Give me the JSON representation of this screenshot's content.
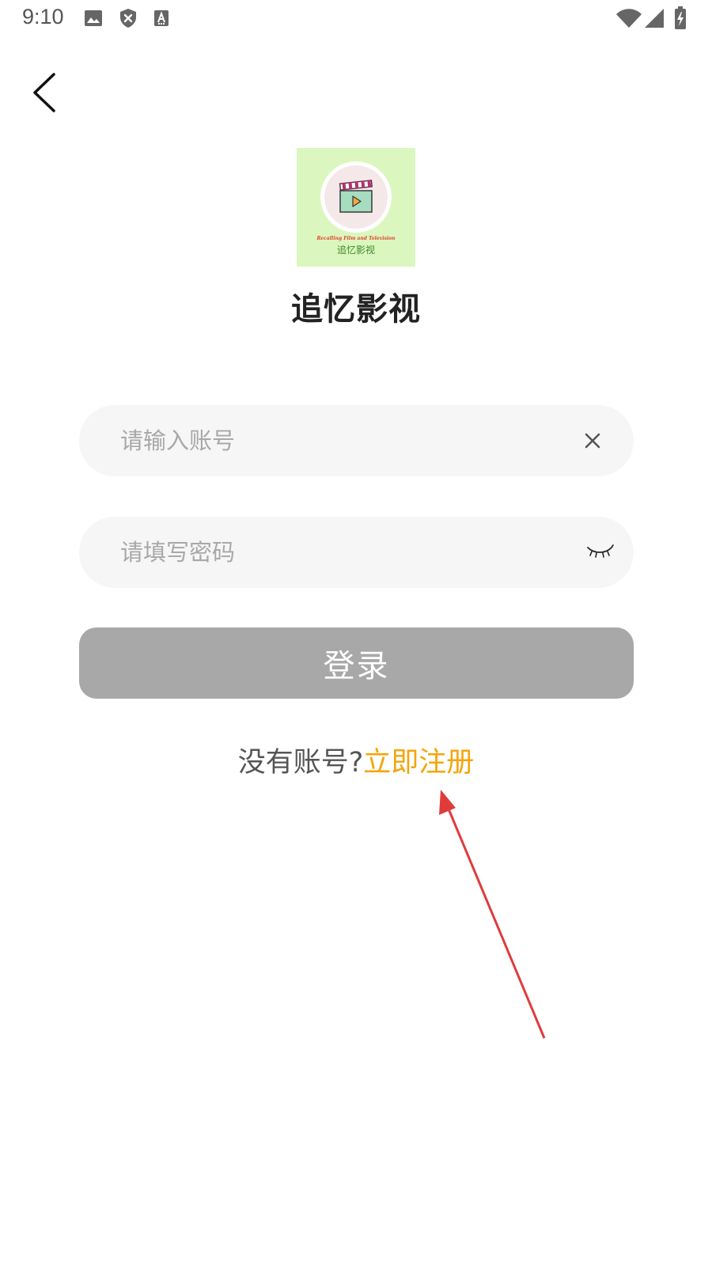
{
  "status_bar": {
    "time": "9:10",
    "icons": [
      "image-icon",
      "shield-icon",
      "font-download-icon",
      "wifi-icon",
      "signal-icon",
      "battery-charging-icon"
    ]
  },
  "header": {
    "back_icon": "chevron-left-icon"
  },
  "logo": {
    "caption_en": "Recalling Film and Television",
    "caption_cn": "追忆影视",
    "colors": {
      "background": "#dbf7bf",
      "circle": "#f4e8e8",
      "clapper": "#a6dcc0",
      "play": "#f2a93b",
      "accent": "#b0336f"
    }
  },
  "app": {
    "title": "追忆影视"
  },
  "form": {
    "account": {
      "value": "",
      "placeholder": "请输入账号",
      "action_icon": "clear-icon"
    },
    "password": {
      "value": "",
      "placeholder": "请填写密码",
      "action_icon": "eye-closed-icon"
    },
    "login_label": "登录"
  },
  "register": {
    "prompt": "没有账号?",
    "link_label": "立即注册"
  },
  "colors": {
    "accent": "#f5a40a",
    "button_disabled": "#a8a8a8",
    "field_bg": "#f6f6f6",
    "annotation": "#e03b3b"
  }
}
